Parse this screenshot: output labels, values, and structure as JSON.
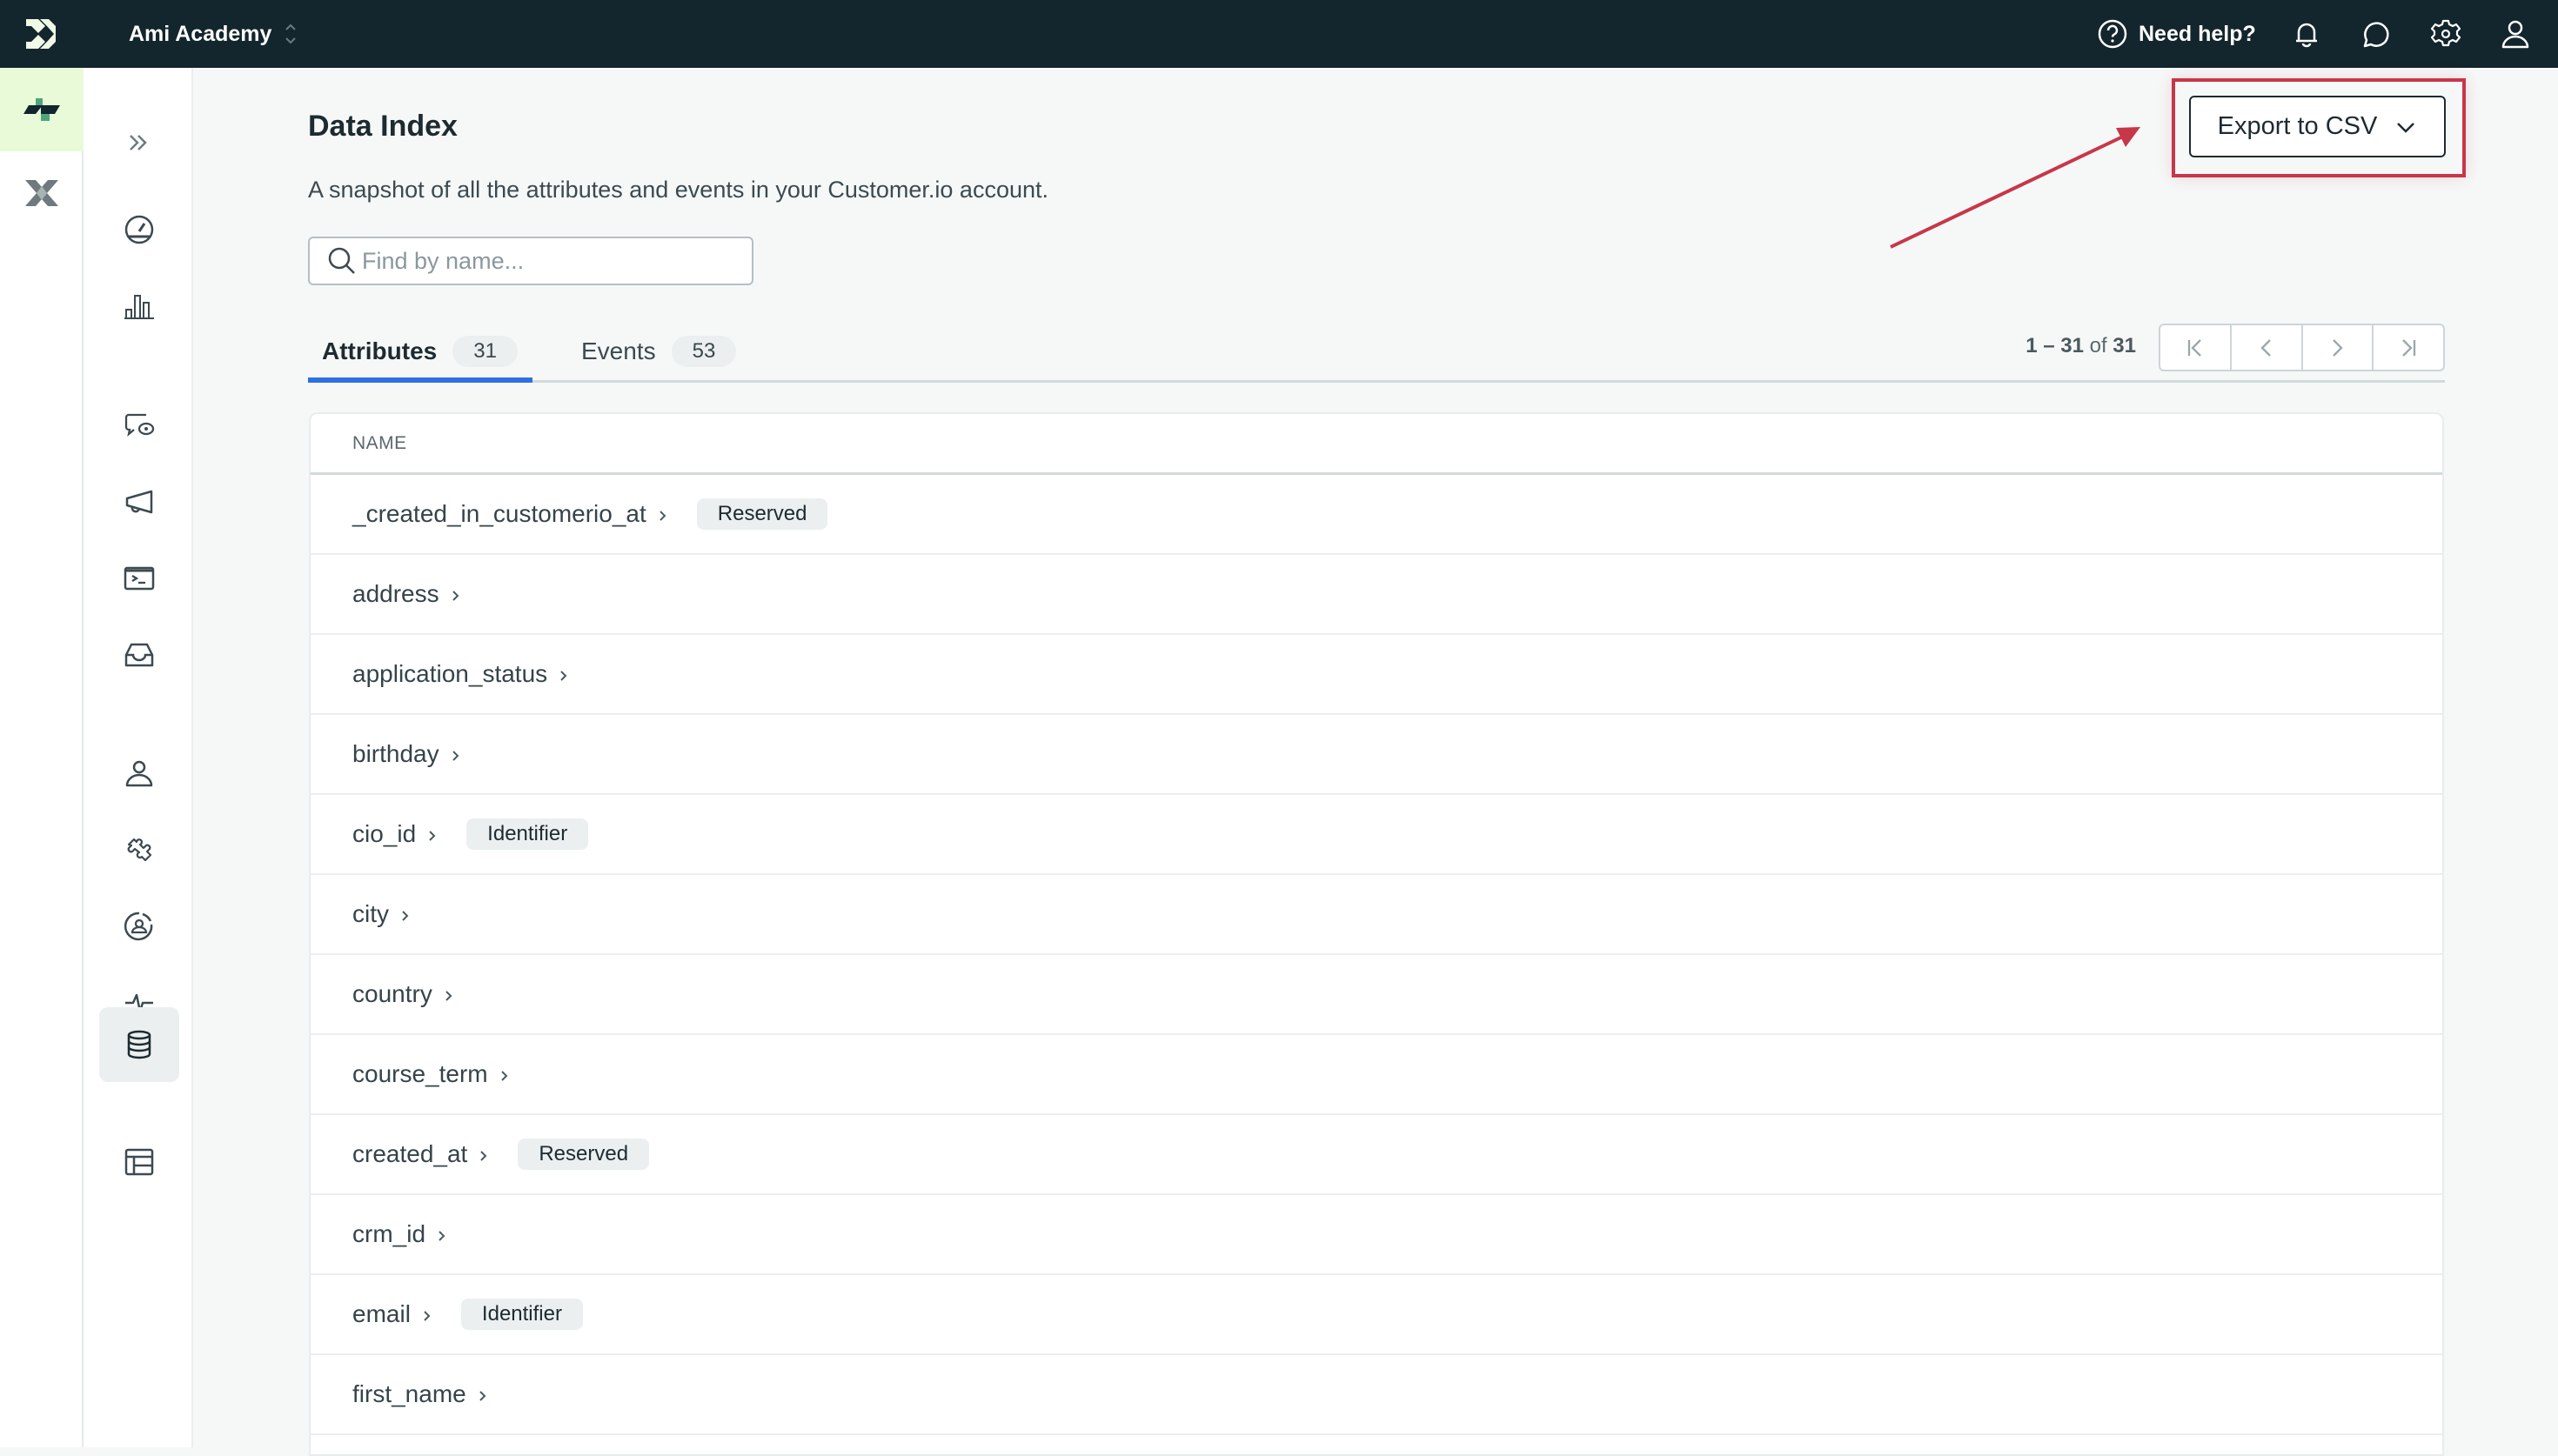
{
  "topbar": {
    "workspace_name": "Ami Academy",
    "help_label": "Need help?",
    "icons": [
      "help-icon",
      "bell-icon",
      "chat-icon",
      "gear-icon",
      "user-icon"
    ]
  },
  "rail_primary": {
    "items": [
      {
        "name": "journeys",
        "icon": "journeys-logo-icon",
        "active": true
      },
      {
        "name": "data-pipelines",
        "icon": "pipelines-x-icon",
        "active": false
      }
    ]
  },
  "rail_secondary": {
    "items": [
      {
        "name": "expand",
        "icon": "double-chevron-right-icon"
      },
      {
        "name": "dashboard",
        "icon": "speedometer-icon"
      },
      {
        "name": "reports",
        "icon": "bar-chart-icon"
      },
      {
        "name": "messages",
        "icon": "message-eye-icon"
      },
      {
        "name": "broadcasts",
        "icon": "megaphone-icon"
      },
      {
        "name": "transactional",
        "icon": "terminal-icon"
      },
      {
        "name": "inbox",
        "icon": "inbox-icon"
      },
      {
        "name": "people",
        "icon": "person-icon"
      },
      {
        "name": "integrations",
        "icon": "puzzle-icon"
      },
      {
        "name": "segments",
        "icon": "segment-person-icon"
      },
      {
        "name": "activity",
        "icon": "pulse-icon"
      },
      {
        "name": "data-index",
        "icon": "database-icon",
        "active": true
      },
      {
        "name": "objects",
        "icon": "table-layout-icon"
      }
    ]
  },
  "page": {
    "title": "Data Index",
    "subtitle": "A snapshot of all the attributes and events in your Customer.io account.",
    "search_placeholder": "Find by name...",
    "search_value": "",
    "export_label": "Export to CSV"
  },
  "tabs": [
    {
      "label": "Attributes",
      "count": "31",
      "active": true
    },
    {
      "label": "Events",
      "count": "53",
      "active": false
    }
  ],
  "pagination": {
    "range_start": "1",
    "range_sep": " – ",
    "range_end": "31",
    "of_label": " of ",
    "total": "31"
  },
  "table": {
    "columns": [
      "NAME"
    ],
    "rows": [
      {
        "name": "_created_in_customerio_at",
        "badge": "Reserved"
      },
      {
        "name": "address",
        "badge": null
      },
      {
        "name": "application_status",
        "badge": null
      },
      {
        "name": "birthday",
        "badge": null
      },
      {
        "name": "cio_id",
        "badge": "Identifier"
      },
      {
        "name": "city",
        "badge": null
      },
      {
        "name": "country",
        "badge": null
      },
      {
        "name": "course_term",
        "badge": null
      },
      {
        "name": "created_at",
        "badge": "Reserved"
      },
      {
        "name": "crm_id",
        "badge": null
      },
      {
        "name": "email",
        "badge": "Identifier"
      },
      {
        "name": "first_name",
        "badge": null
      }
    ]
  },
  "colors": {
    "topbar_bg": "#13252d",
    "active_rail_bg": "#e9fad8",
    "tab_active_underline": "#2f6fe4",
    "annotation_red": "#c8364a"
  }
}
